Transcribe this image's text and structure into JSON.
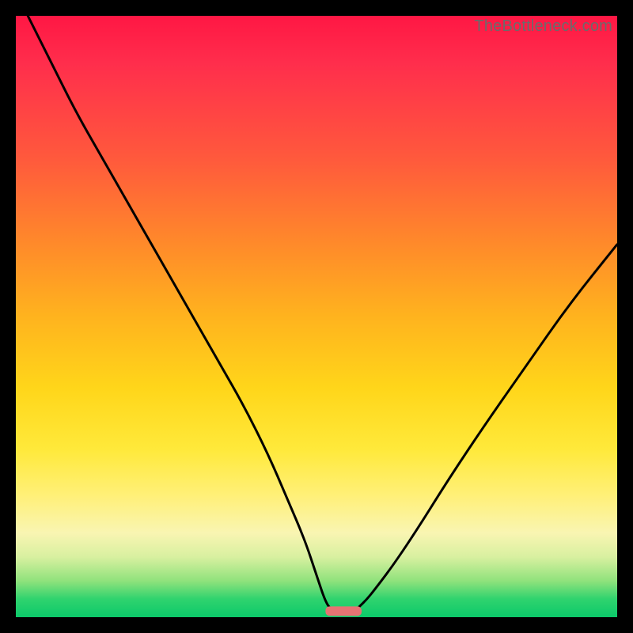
{
  "watermark": "TheBottleneck.com",
  "chart_data": {
    "type": "line",
    "title": "",
    "xlabel": "",
    "ylabel": "",
    "xlim": [
      0,
      100
    ],
    "ylim": [
      0,
      100
    ],
    "series": [
      {
        "name": "left-curve",
        "x": [
          2,
          6,
          10,
          14,
          18,
          22,
          26,
          30,
          34,
          38,
          42,
          45,
          48,
          50,
          51.5,
          52.5
        ],
        "values": [
          100,
          92,
          84,
          77,
          70,
          63,
          56,
          49,
          42,
          35,
          27,
          20,
          13,
          7,
          2.5,
          1.2
        ]
      },
      {
        "name": "right-curve",
        "x": [
          56.5,
          58,
          60,
          63,
          67,
          72,
          78,
          85,
          92,
          100
        ],
        "values": [
          1.2,
          2.5,
          5,
          9,
          15,
          23,
          32,
          42,
          52,
          62
        ]
      }
    ],
    "marker": {
      "name": "bottleneck-marker",
      "x_center": 54.5,
      "width": 6,
      "y": 1.0,
      "color": "#e57373"
    },
    "background_gradient": {
      "top": "#ff1744",
      "mid": "#ffd61a",
      "bottom": "#0cc96a"
    }
  }
}
